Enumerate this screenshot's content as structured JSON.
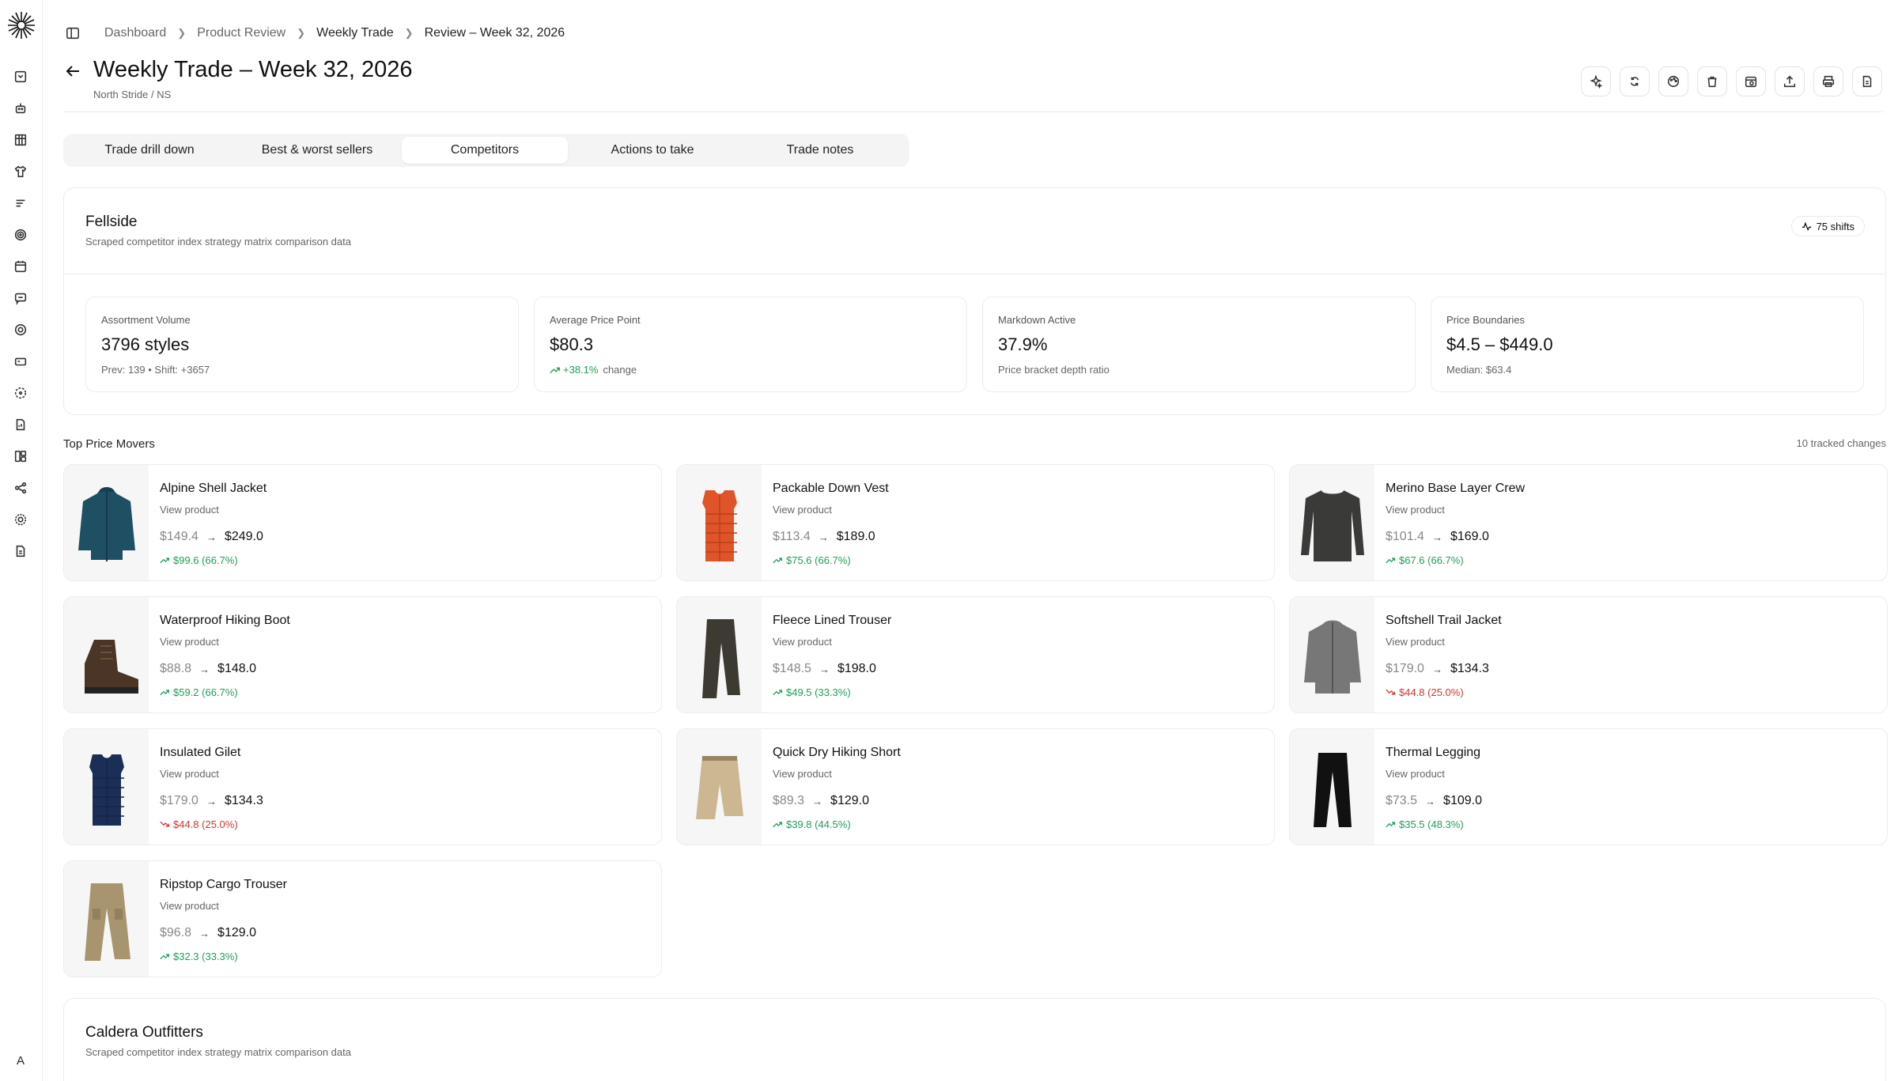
{
  "breadcrumb": [
    "Dashboard",
    "Product Review",
    "Weekly Trade",
    "Review – Week 32, 2026"
  ],
  "header": {
    "title": "Weekly Trade – Week 32, 2026",
    "subtitle": "North Stride / NS"
  },
  "tabs": [
    {
      "label": "Trade drill down",
      "active": false
    },
    {
      "label": "Best & worst sellers",
      "active": false
    },
    {
      "label": "Competitors",
      "active": true
    },
    {
      "label": "Actions to take",
      "active": false
    },
    {
      "label": "Trade notes",
      "active": false
    }
  ],
  "competitor": {
    "name": "Fellside",
    "description": "Scraped competitor index strategy matrix comparison data",
    "badge": "75 shifts",
    "metrics": [
      {
        "label": "Assortment Volume",
        "value": "3796 styles",
        "sub": "Prev: 139 • Shift: +3657"
      },
      {
        "label": "Average Price Point",
        "value": "$80.3",
        "change": "+38.1%",
        "sub": "change"
      },
      {
        "label": "Markdown Active",
        "value": "37.9%",
        "sub": "Price bracket depth ratio"
      },
      {
        "label": "Price Boundaries",
        "value": "$4.5 – $449.0",
        "sub": "Median: $63.4"
      }
    ]
  },
  "movers": {
    "title": "Top Price Movers",
    "count_label": "10 tracked changes",
    "view_label": "View product",
    "items": [
      {
        "name": "Alpine Shell Jacket",
        "old": "$149.4",
        "new": "$249.0",
        "change": "$99.6 (66.7%)",
        "direction": "up",
        "icon": "jacket-teal"
      },
      {
        "name": "Packable Down Vest",
        "old": "$113.4",
        "new": "$189.0",
        "change": "$75.6 (66.7%)",
        "direction": "up",
        "icon": "vest-orange"
      },
      {
        "name": "Merino Base Layer Crew",
        "old": "$101.4",
        "new": "$169.0",
        "change": "$67.6 (66.7%)",
        "direction": "up",
        "icon": "crew-charcoal"
      },
      {
        "name": "Waterproof Hiking Boot",
        "old": "$88.8",
        "new": "$148.0",
        "change": "$59.2 (66.7%)",
        "direction": "up",
        "icon": "boot-brown"
      },
      {
        "name": "Fleece Lined Trouser",
        "old": "$148.5",
        "new": "$198.0",
        "change": "$49.5 (33.3%)",
        "direction": "up",
        "icon": "trouser-dark"
      },
      {
        "name": "Softshell Trail Jacket",
        "old": "$179.0",
        "new": "$134.3",
        "change": "$44.8 (25.0%)",
        "direction": "down",
        "icon": "jacket-grey"
      },
      {
        "name": "Insulated Gilet",
        "old": "$179.0",
        "new": "$134.3",
        "change": "$44.8 (25.0%)",
        "direction": "down",
        "icon": "vest-navy"
      },
      {
        "name": "Quick Dry Hiking Short",
        "old": "$89.3",
        "new": "$129.0",
        "change": "$39.8 (44.5%)",
        "direction": "up",
        "icon": "short-khaki"
      },
      {
        "name": "Thermal Legging",
        "old": "$73.5",
        "new": "$109.0",
        "change": "$35.5 (48.3%)",
        "direction": "up",
        "icon": "legging-black"
      },
      {
        "name": "Ripstop Cargo Trouser",
        "old": "$96.8",
        "new": "$129.0",
        "change": "$32.3 (33.3%)",
        "direction": "up",
        "icon": "trouser-khaki"
      }
    ]
  },
  "competitor2": {
    "name": "Caldera Outfitters",
    "description": "Scraped competitor index strategy matrix comparison data"
  },
  "user": {
    "initial": "A"
  },
  "colors": {
    "up": "#1f9e57",
    "down": "#d2362c",
    "border": "#ececec",
    "tab_bg": "#f4f4f4"
  }
}
